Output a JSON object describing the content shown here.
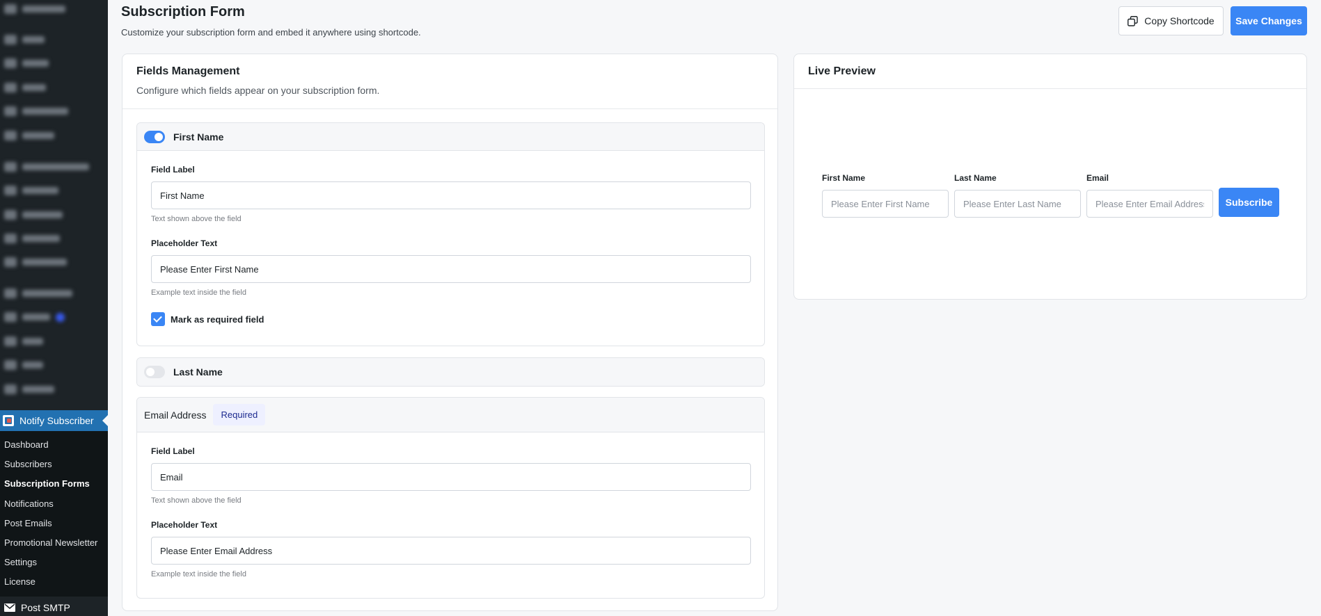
{
  "sidebar": {
    "active_plugin": "Notify Subscriber",
    "submenu": [
      "Dashboard",
      "Subscribers",
      "Subscription Forms",
      "Notifications",
      "Post Emails",
      "Promotional Newsletter",
      "Settings",
      "License"
    ],
    "current_item": "Subscription Forms",
    "next_menu": "Post SMTP"
  },
  "header": {
    "title": "Subscription Form",
    "subtitle": "Customize your subscription form and embed it anywhere using shortcode.",
    "copy_label": "Copy Shortcode",
    "save_label": "Save Changes"
  },
  "fields_card": {
    "title": "Fields Management",
    "description": "Configure which fields appear on your subscription form.",
    "first_name": {
      "name": "First Name",
      "enabled": true,
      "label_title": "Field Label",
      "label_value": "First Name",
      "label_help": "Text shown above the field",
      "placeholder_title": "Placeholder Text",
      "placeholder_value": "Please Enter First Name",
      "placeholder_help": "Example text inside the field",
      "required_label": "Mark as required field",
      "required": true
    },
    "last_name": {
      "name": "Last Name",
      "enabled": false
    },
    "email": {
      "name": "Email Address",
      "badge": "Required",
      "label_title": "Field Label",
      "label_value": "Email",
      "label_help": "Text shown above the field",
      "placeholder_title": "Placeholder Text",
      "placeholder_value": "Please Enter Email Address",
      "placeholder_help": "Example text inside the field"
    }
  },
  "preview_card": {
    "title": "Live Preview",
    "fields": [
      {
        "label": "First Name",
        "placeholder": "Please Enter First Name"
      },
      {
        "label": "Last Name",
        "placeholder": "Please Enter Last Name"
      },
      {
        "label": "Email",
        "placeholder": "Please Enter Email Address"
      }
    ],
    "button": "Subscribe"
  },
  "colors": {
    "accent": "#3a86f5",
    "sidebar_bg": "#1d2327",
    "sidebar_active": "#2271b1",
    "badge_bg": "#eef0ff"
  },
  "icons": [
    "copy-icon",
    "plugin-icon",
    "mail-icon",
    "check-icon"
  ]
}
